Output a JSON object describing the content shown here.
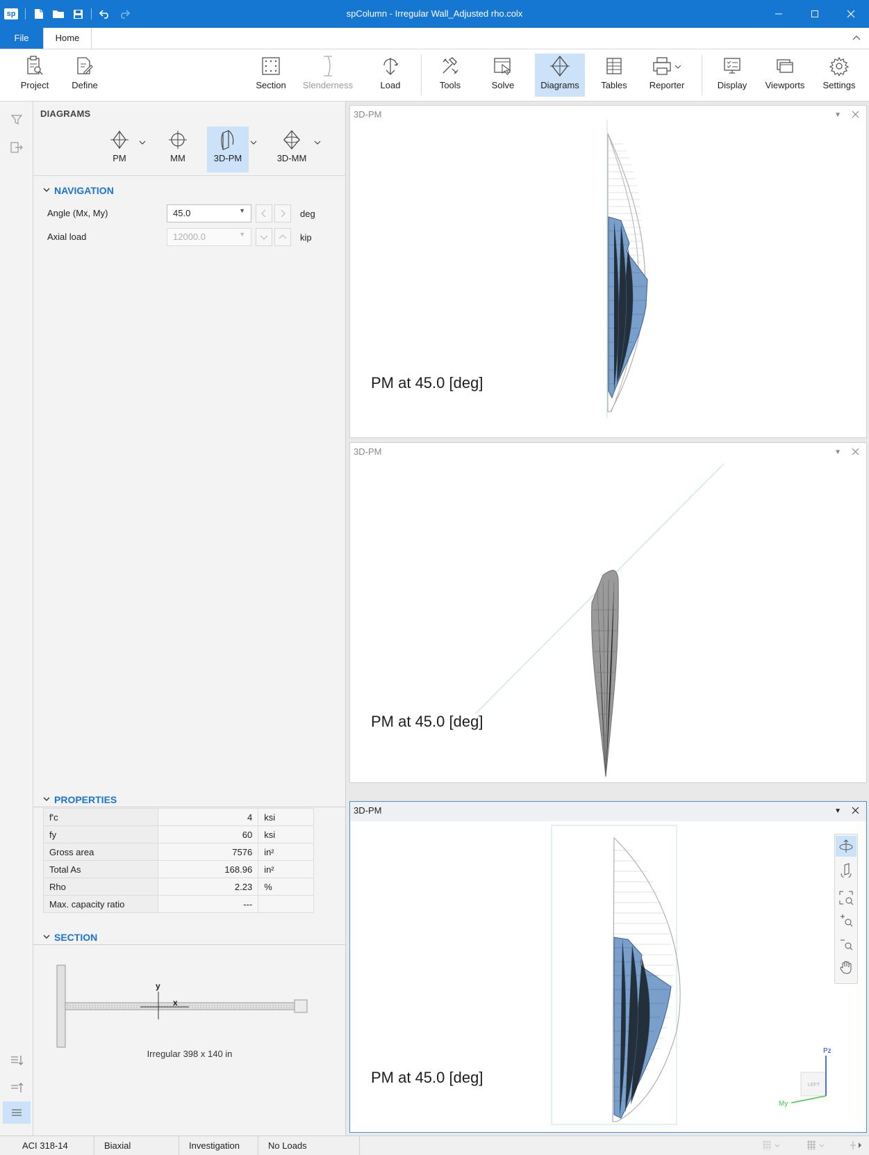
{
  "window": {
    "title": "spColumn - Irregular Wall_Adjusted rho.colx",
    "logo": "sp",
    "quick_access": [
      "new-file-icon",
      "open-folder-icon",
      "save-icon",
      "undo-icon",
      "redo-icon"
    ]
  },
  "tabs": {
    "file": "File",
    "home": "Home"
  },
  "ribbon": {
    "project": "Project",
    "define": "Define",
    "section": "Section",
    "slenderness": "Slenderness",
    "load": "Load",
    "tools": "Tools",
    "solve": "Solve",
    "diagrams": "Diagrams",
    "tables": "Tables",
    "reporter": "Reporter",
    "display": "Display",
    "viewports": "Viewports",
    "settings": "Settings"
  },
  "panel": {
    "header": "DIAGRAMS",
    "types": {
      "pm": "PM",
      "mm": "MM",
      "pm3d": "3D-PM",
      "mm3d": "3D-MM"
    },
    "navigation": {
      "title": "NAVIGATION",
      "angle_label": "Angle (Mx, My)",
      "angle_value": "45.0",
      "angle_unit": "deg",
      "axial_label": "Axial load",
      "axial_value": "12000.0",
      "axial_unit": "kip"
    },
    "properties": {
      "title": "PROPERTIES",
      "rows": [
        {
          "name": "f'c",
          "value": "4",
          "unit": "ksi"
        },
        {
          "name": "fy",
          "value": "60",
          "unit": "ksi"
        },
        {
          "name": "Gross area",
          "value": "7576",
          "unit": "in²"
        },
        {
          "name": "Total As",
          "value": "168.96",
          "unit": "in²"
        },
        {
          "name": "Rho",
          "value": "2.23",
          "unit": "%"
        },
        {
          "name": "Max. capacity ratio",
          "value": "---",
          "unit": ""
        }
      ]
    },
    "section": {
      "title": "SECTION",
      "caption": "Irregular 398 x 140 in",
      "axis_x": "x",
      "axis_y": "y"
    }
  },
  "viewports": [
    {
      "title": "3D-PM",
      "caption": "PM at 45.0 [deg]"
    },
    {
      "title": "3D-PM",
      "caption": "PM at 45.0 [deg]"
    },
    {
      "title": "3D-PM",
      "caption": "PM at 45.0 [deg]"
    }
  ],
  "gizmo": {
    "pz": "Pz",
    "my": "My",
    "face": "LEFT"
  },
  "statusbar": {
    "code": "ACI 318-14",
    "mode": "Biaxial",
    "run": "Investigation",
    "loads": "No Loads"
  },
  "colors": {
    "titlebar": "#1677d2",
    "accent": "#1a74d1",
    "active_bg": "#cce2f8",
    "surface_fill": "#7a9fcb",
    "mesh": "#a8a8a8"
  }
}
